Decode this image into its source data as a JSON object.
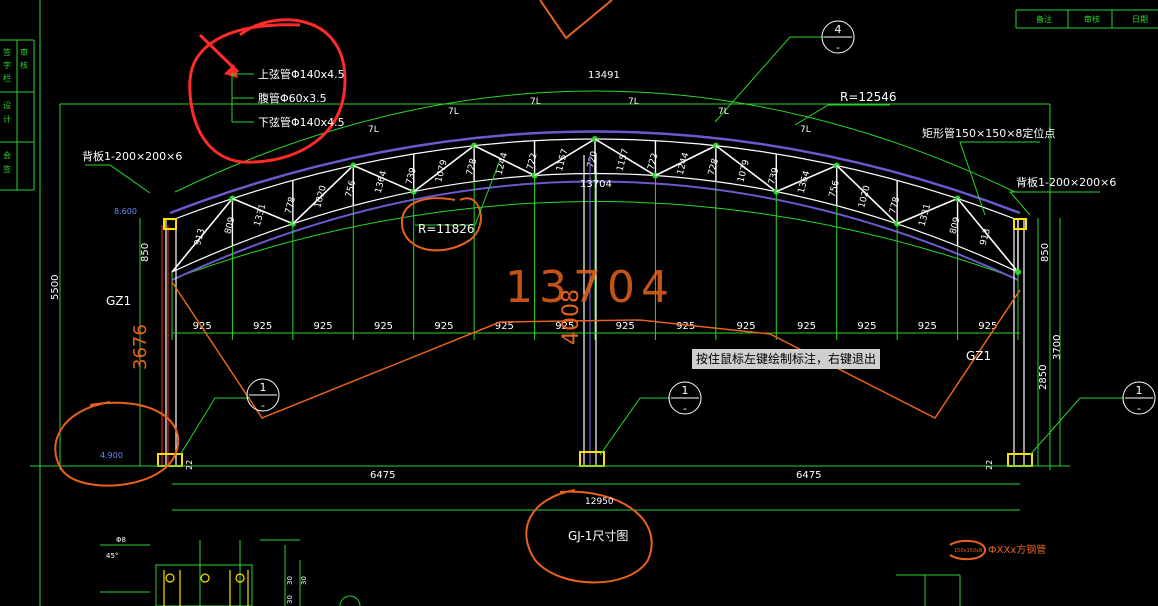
{
  "drawing": {
    "title": "GJ-1尺寸图",
    "legend": {
      "top_chord": "上弦管Φ140x4.5",
      "web": "腹管Φ60x3.5",
      "bottom_chord": "下弦管Φ140x4.5"
    },
    "radius_outer": "R=12546",
    "radius_inner": "R=11826",
    "arc_top": "13491",
    "arc_mid": "13704",
    "arc_mid_big": "13704",
    "center_vertical_big": "4008",
    "backplate_left": "背板1-200×200×6",
    "backplate_right": "背板1-200×200×6",
    "rect_tube": "矩形管150×150×8定位点",
    "column_left": "GZ1",
    "column_right": "GZ1",
    "elev_top": "8.600",
    "elev_bottom": "4.900",
    "dim_left_total": "5500",
    "dim_left_top": "850",
    "dim_left_col": "3676",
    "dim_right_top": "850",
    "dim_right_mid": "3700",
    "dim_right_low": "2850",
    "dim_span_left": "6475",
    "dim_span_right": "6475",
    "dim_total": "12950",
    "dim_small_left": "22",
    "dim_small_right": "22",
    "bay_labels": [
      "925",
      "925",
      "925",
      "925",
      "925",
      "925",
      "925",
      "925",
      "925",
      "925",
      "925",
      "925",
      "925",
      "925"
    ],
    "member_labels": [
      "913",
      "809",
      "1331",
      "778",
      "1020",
      "756",
      "1364",
      "739",
      "1079",
      "728",
      "1244",
      "722",
      "1157",
      "720",
      "1157",
      "722",
      "1244",
      "728",
      "1079",
      "739",
      "1364",
      "756",
      "1020",
      "778",
      "1331",
      "809",
      "913"
    ],
    "gauge": "7L",
    "detail_marker": "1",
    "detail_sub": "-",
    "detail_top": "4",
    "header_cells": [
      "备注",
      "审核",
      "日期"
    ],
    "side_tabs": [
      "签",
      "字",
      "栏",
      "审",
      "核",
      "设",
      "计",
      "会",
      "签"
    ],
    "tube_note": "ФXXx方钢管",
    "small_note": "150x150x8",
    "detail_dims": [
      "45°",
      "Φ8",
      "30",
      "30",
      "30"
    ]
  },
  "tooltip": "按住鼠标左键绘制标注，右键退出",
  "colors": {
    "green": "#2ad62a",
    "white": "#ffffff",
    "orange": "#e8621c",
    "red": "#ff2a2a",
    "cyan": "#2fd8e0",
    "yellow": "#ffe000",
    "purple": "#6a5acd",
    "magenta": "#d040d0"
  }
}
